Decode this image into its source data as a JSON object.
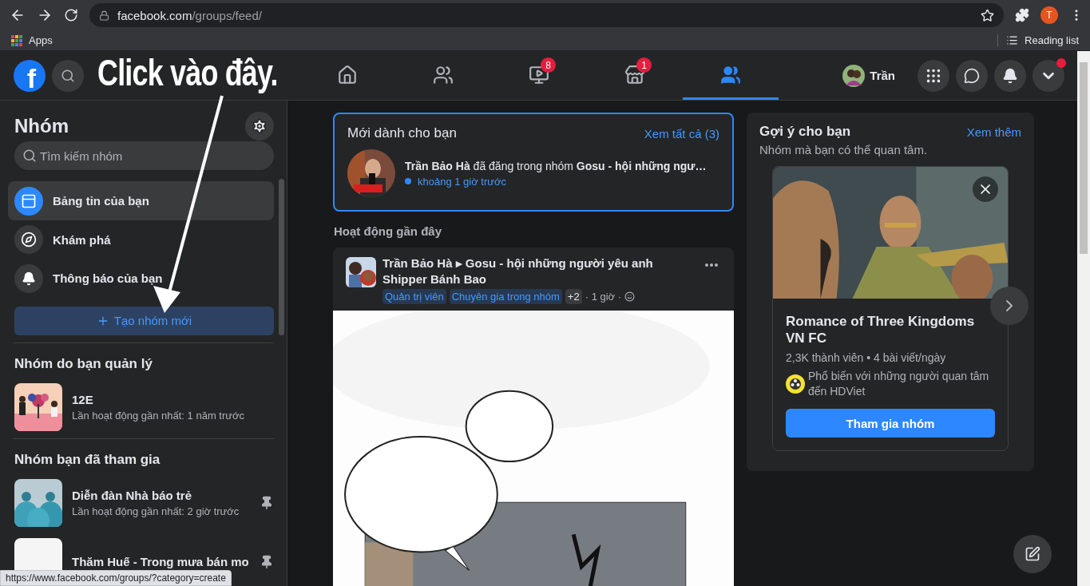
{
  "browser": {
    "url_host": "facebook.com",
    "url_path": "/groups/feed/",
    "profile_initial": "T",
    "bookmarks": [
      {
        "label": "Apps"
      }
    ],
    "reading_list": "Reading list"
  },
  "annotation": {
    "text": "Click vào đây."
  },
  "header": {
    "logo": "f",
    "nav": [
      {
        "kind": "home",
        "selected": false
      },
      {
        "kind": "friends",
        "selected": false
      },
      {
        "kind": "watch",
        "selected": false,
        "badge": "8"
      },
      {
        "kind": "marketplace",
        "selected": false,
        "badge": "1"
      },
      {
        "kind": "groups",
        "selected": true
      }
    ],
    "user_name": "Trần",
    "buttons": [
      {
        "kind": "menu",
        "dot": false
      },
      {
        "kind": "messenger",
        "dot": false
      },
      {
        "kind": "notifications",
        "dot": false
      },
      {
        "kind": "account",
        "dot": true
      }
    ]
  },
  "sidebar": {
    "title": "Nhóm",
    "search": {
      "placeholder": "Tìm kiếm nhóm"
    },
    "items": [
      {
        "kind": "feed",
        "label": "Bảng tin của bạn",
        "selected": true
      },
      {
        "kind": "discover",
        "label": "Khám phá",
        "selected": false
      },
      {
        "kind": "notifications",
        "label": "Thông báo của bạn",
        "selected": false
      }
    ],
    "create_button": "Tạo nhóm mới",
    "sections": [
      {
        "title": "Nhóm do bạn quản lý",
        "groups": [
          {
            "name": "12E",
            "activity": "Lần hoạt động gần nhất: 1 năm trước",
            "pinned": false
          }
        ]
      },
      {
        "title": "Nhóm bạn đã tham gia",
        "groups": [
          {
            "name": "Diễn đàn Nhà báo trẻ",
            "activity": "Lần hoạt động gần nhất: 2 giờ trước",
            "pinned": true
          },
          {
            "name": "Thăm Huế - Trong mưa bán mo",
            "pinned": true
          }
        ]
      }
    ]
  },
  "feed": {
    "new_for_you": {
      "title": "Mới dành cho bạn",
      "see_all": "Xem tất cả (3)",
      "notification": {
        "text": "**Trần Bảo Hà** đã đăng trong nhóm **Gosu - hội những ngư…**",
        "time": "khoảng 1 giờ trước",
        "unread": true
      }
    },
    "recent_title": "Hoạt động gần đây",
    "post": {
      "title": "Trần Bảo Hà ▸ Gosu - hội những người yêu anh Shipper Bánh Bao",
      "badges": [
        "Quản trị viên",
        "Chuyên gia trong nhóm"
      ],
      "more_badges": "+2",
      "meta": "· 1 giờ ·",
      "image": {
        "kind": "picture"
      }
    }
  },
  "suggestions": {
    "title": "Gợi ý cho bạn",
    "see_more": "Xem thêm",
    "subtitle": "Nhóm mà bạn có thể quan tâm.",
    "card": {
      "name": "Romance of Three Kingdoms VN FC",
      "stats": "2,3K thành viên • 4 bài viết/ngày",
      "reason": "Phổ biến với những người quan tâm đến HDViet",
      "join": "Tham gia nhóm"
    }
  },
  "status_url": "https://www.facebook.com/groups/?category=create"
}
